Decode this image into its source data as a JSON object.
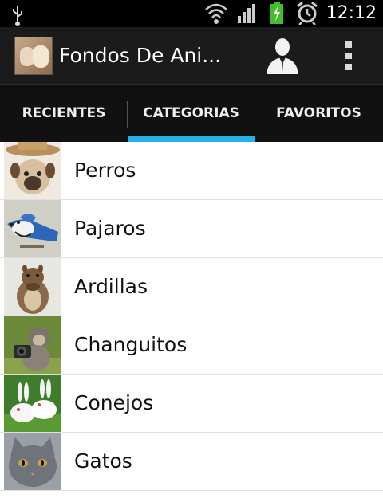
{
  "status_bar": {
    "time": "12:12",
    "icons": [
      "usb-icon",
      "wifi-icon",
      "signal-icon",
      "battery-charging-icon",
      "alarm-icon"
    ],
    "colors": {
      "battery": "#3fbf29",
      "background": "#000000"
    }
  },
  "action_bar": {
    "title": "Fondos De Ani...",
    "icons": [
      "app-logo-icon",
      "profile-icon",
      "overflow-menu-icon"
    ]
  },
  "tabs": [
    {
      "label": "RECIENTES",
      "selected": false
    },
    {
      "label": "CATEGORIAS",
      "selected": true
    },
    {
      "label": "FAVORITOS",
      "selected": false
    }
  ],
  "accent_color": "#27b0e6",
  "categories": [
    {
      "label": "Perros",
      "thumb": "dog-thumbnail"
    },
    {
      "label": "Pajaros",
      "thumb": "bird-thumbnail"
    },
    {
      "label": "Ardillas",
      "thumb": "squirrel-thumbnail"
    },
    {
      "label": "Changuitos",
      "thumb": "monkey-thumbnail"
    },
    {
      "label": "Conejos",
      "thumb": "rabbit-thumbnail"
    },
    {
      "label": "Gatos",
      "thumb": "cat-thumbnail"
    }
  ]
}
